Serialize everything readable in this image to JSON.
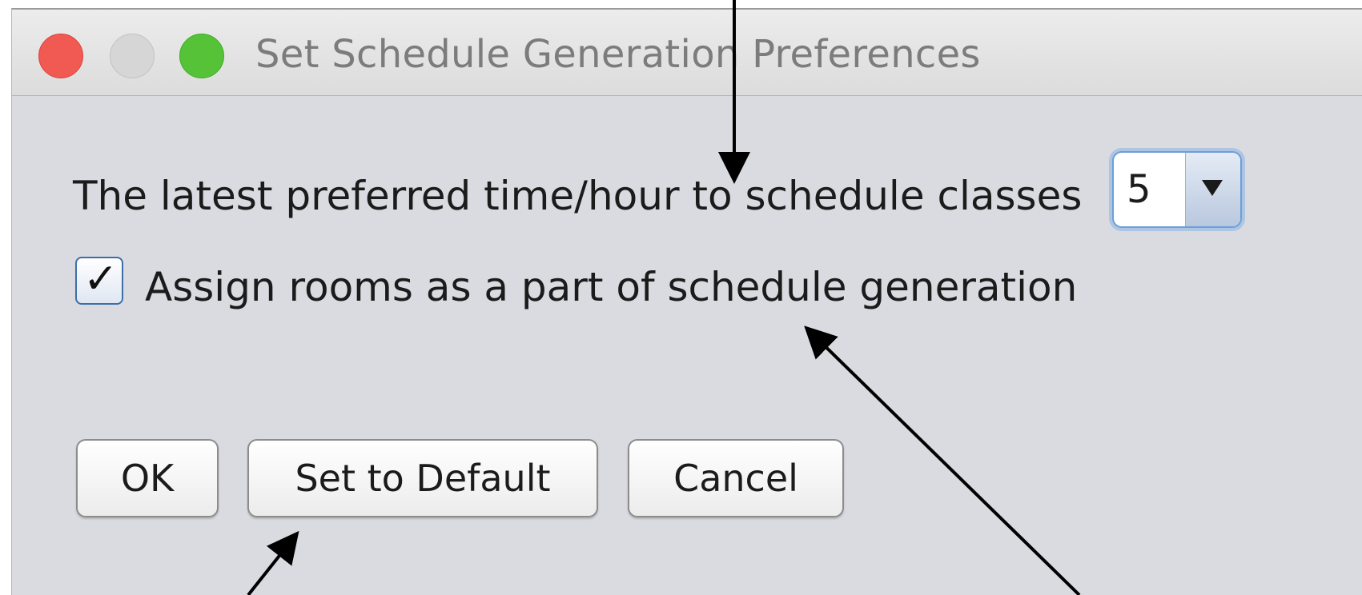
{
  "window": {
    "title": "Set Schedule Generation Preferences",
    "buttons": [
      "close",
      "minimize",
      "zoom"
    ]
  },
  "preferences": {
    "latest_time_label": "The latest preferred time/hour to schedule classes",
    "latest_time_value": "5",
    "assign_rooms_label": "Assign rooms as a part of schedule generation",
    "assign_rooms_checked": true,
    "checkmark": "✓"
  },
  "buttons": {
    "ok_label": "OK",
    "default_label": "Set to Default",
    "cancel_label": "Cancel"
  },
  "colors": {
    "close": "#f05a52",
    "minimize": "#d6d6d6",
    "zoom": "#55c238",
    "focus_ring": "#6b9fd8"
  }
}
